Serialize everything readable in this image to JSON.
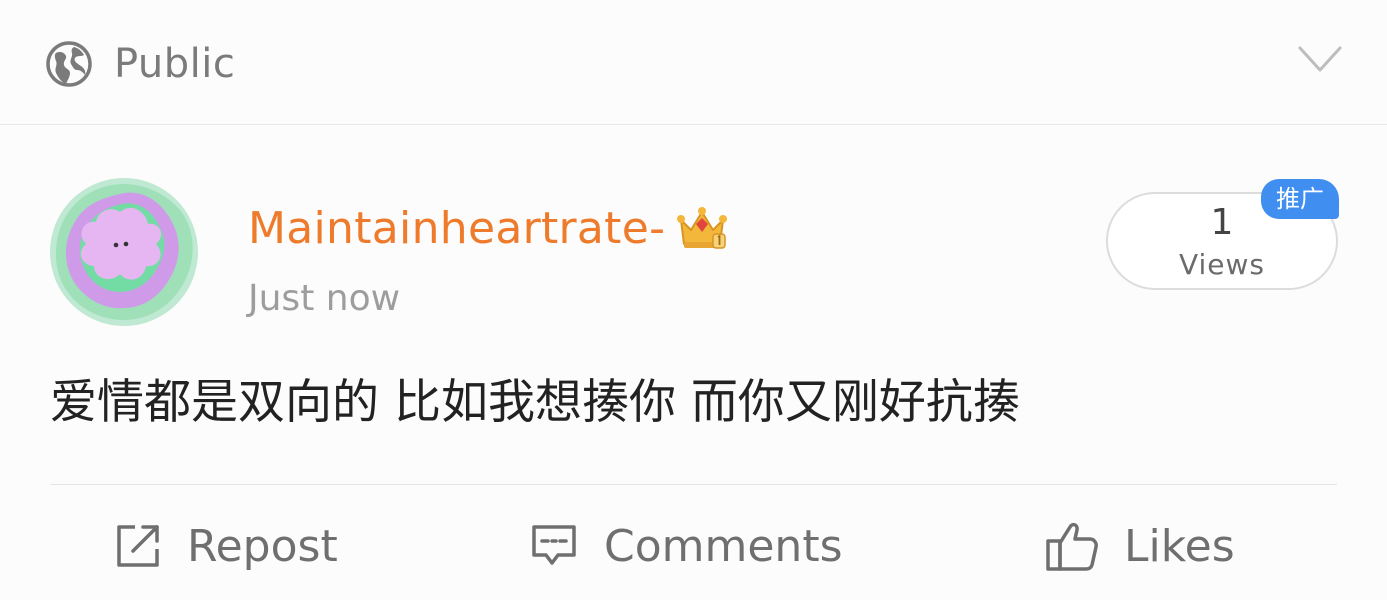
{
  "visibility": {
    "label": "Public",
    "icon": "globe-icon",
    "dropdown_icon": "chevron-down-icon"
  },
  "post": {
    "author": {
      "name": "Maintainheartrate-",
      "badge_icon": "crown-icon",
      "name_color": "#ee7b2c"
    },
    "timestamp": "Just now",
    "views": {
      "count": "1",
      "label": "Views",
      "promo_badge": "推广",
      "promo_color": "#3f8ef0"
    },
    "text": "爱情都是双向的 比如我想揍你 而你又刚好抗揍"
  },
  "actions": {
    "repost": "Repost",
    "comments": "Comments",
    "likes": "Likes"
  }
}
